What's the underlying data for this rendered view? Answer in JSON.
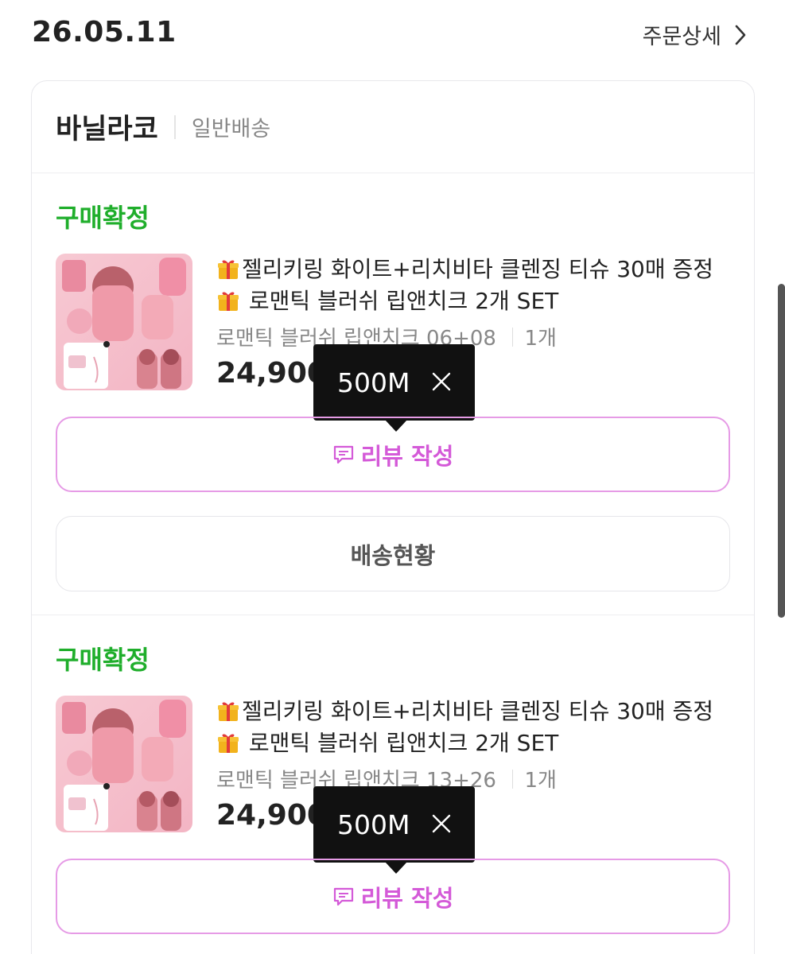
{
  "order": {
    "date": "26.05.11",
    "detail_label": "주문상세"
  },
  "card": {
    "seller": "바닐라코",
    "delivery_type": "일반배송",
    "items": [
      {
        "status": "구매확정",
        "name_line1": "젤리키링 화이트+리치비타 클렌징 티슈 30매 증정",
        "name_line2": " 로맨틱 블러쉬 립앤치크 2개 SET",
        "option": "로맨틱 블러쉬 립앤치크 06+08",
        "quantity": "1개",
        "price": "24,900",
        "tooltip": "500M",
        "review_label": "리뷰 작성",
        "shipping_label": "배송현황"
      },
      {
        "status": "구매확정",
        "name_line1": "젤리키링 화이트+리치비타 클렌징 티슈 30매 증정",
        "name_line2": " 로맨틱 블러쉬 립앤치크 2개 SET",
        "option": "로맨틱 블러쉬 립앤치크 13+26",
        "quantity": "1개",
        "price": "24,900",
        "tooltip": "500M",
        "review_label": "리뷰 작성"
      }
    ]
  },
  "colors": {
    "status_green": "#1fae2b",
    "review_pink": "#d45ad8",
    "review_border": "#e69be6",
    "tooltip_bg": "#111111"
  },
  "icons": {
    "detail_chevron": "chevron-right-icon",
    "gift": "gift-icon",
    "review": "comment-icon",
    "tooltip_close": "close-icon"
  }
}
